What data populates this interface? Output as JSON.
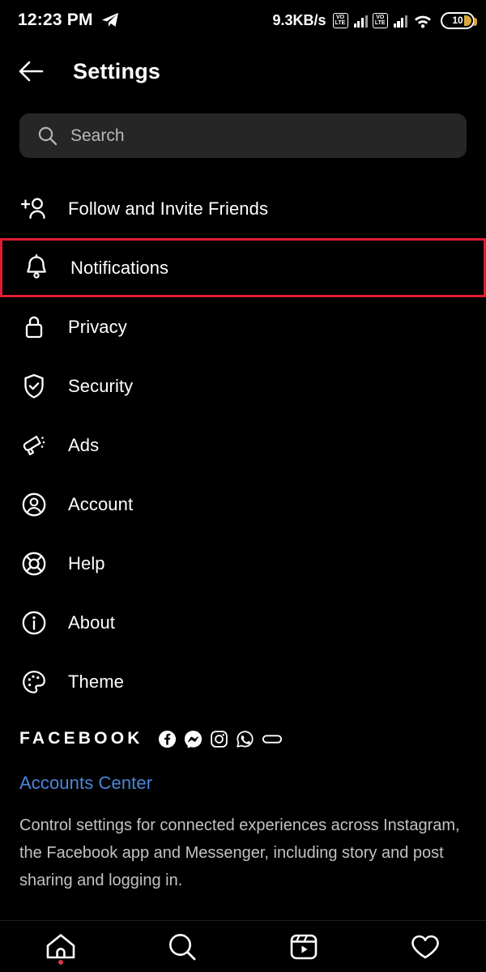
{
  "status_bar": {
    "time": "12:23 PM",
    "notification_icon": "telegram-paper-plane-icon",
    "network_speed": "9.3KB/s",
    "sim1_label_top": "VO",
    "sim1_label_bottom": "LTE",
    "sim2_label_top": "VO",
    "sim2_label_bottom": "LTE",
    "wifi_icon": "wifi-icon",
    "battery_level": "10"
  },
  "header": {
    "back_icon": "back-arrow-icon",
    "title": "Settings"
  },
  "search": {
    "icon": "search-icon",
    "placeholder": "Search",
    "value": ""
  },
  "menu": {
    "items": [
      {
        "label": "Follow and Invite Friends",
        "icon": "add-person-icon",
        "highlighted": false
      },
      {
        "label": "Notifications",
        "icon": "bell-icon",
        "highlighted": true
      },
      {
        "label": "Privacy",
        "icon": "lock-icon",
        "highlighted": false
      },
      {
        "label": "Security",
        "icon": "shield-check-icon",
        "highlighted": false
      },
      {
        "label": "Ads",
        "icon": "megaphone-icon",
        "highlighted": false
      },
      {
        "label": "Account",
        "icon": "account-circle-icon",
        "highlighted": false
      },
      {
        "label": "Help",
        "icon": "lifebuoy-icon",
        "highlighted": false
      },
      {
        "label": "About",
        "icon": "info-circle-icon",
        "highlighted": false
      },
      {
        "label": "Theme",
        "icon": "palette-icon",
        "highlighted": false
      }
    ]
  },
  "facebook_section": {
    "brand_word": "FACEBOOK",
    "brand_icons": [
      "facebook-icon",
      "messenger-icon",
      "instagram-icon",
      "whatsapp-icon",
      "oculus-icon"
    ],
    "accounts_center_label": "Accounts Center",
    "description": "Control settings for connected experiences across Instagram, the Facebook app and Messenger, including story and post sharing and logging in."
  },
  "bottom_nav": {
    "items": [
      {
        "icon": "home-icon",
        "badge": true
      },
      {
        "icon": "search-icon",
        "badge": false
      },
      {
        "icon": "reels-icon",
        "badge": false
      },
      {
        "icon": "heart-icon",
        "badge": false
      }
    ]
  },
  "colors": {
    "background": "#000000",
    "highlight_red": "#e01c34",
    "link_blue": "#4a86d8",
    "search_field": "#262626",
    "battery_amber": "#d8a93a"
  }
}
